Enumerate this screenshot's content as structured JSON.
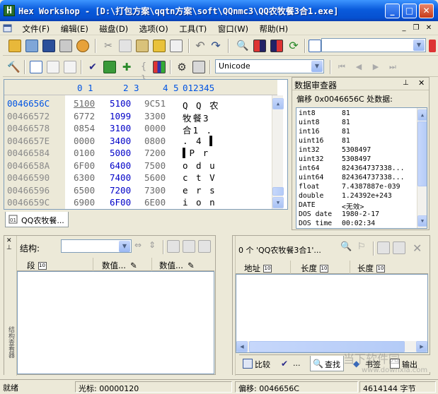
{
  "window": {
    "app_title": "Hex Workshop - [D:\\打包方案\\qqtn方案\\soft\\QQnmc3\\QQ农牧餐3合1.exe]"
  },
  "menu": [
    "文件(F)",
    "编辑(E)",
    "磁盘(D)",
    "选项(O)",
    "工具(T)",
    "窗口(W)",
    "帮助(H)"
  ],
  "toolbar": {
    "encoding_combo": "Unicode",
    "search_combo": ""
  },
  "hex_editor": {
    "header_hex": [
      "0 1",
      "2 3",
      "4 5"
    ],
    "header_ascii": "012345",
    "rows": [
      {
        "addr": "0046656C",
        "h1": "5100",
        "h2": "5100",
        "h3": "9C51",
        "ascii": "Q Q 农"
      },
      {
        "addr": "00466572",
        "h1": "6772",
        "h2": "1099",
        "h3": "3300",
        "ascii": "牧餐3"
      },
      {
        "addr": "00466578",
        "h1": "0854",
        "h2": "3100",
        "h3": "0000",
        "ascii": "合1 ."
      },
      {
        "addr": "0046657E",
        "h1": "0000",
        "h2": "3400",
        "h3": "0800",
        "ascii": ". 4 ▌"
      },
      {
        "addr": "00466584",
        "h1": "0100",
        "h2": "5000",
        "h3": "7200",
        "ascii": "▌P r"
      },
      {
        "addr": "0046658A",
        "h1": "6F00",
        "h2": "6400",
        "h3": "7500",
        "ascii": "o d u"
      },
      {
        "addr": "00466590",
        "h1": "6300",
        "h2": "7400",
        "h3": "5600",
        "ascii": "c t V"
      },
      {
        "addr": "00466596",
        "h1": "6500",
        "h2": "7200",
        "h3": "7300",
        "ascii": "e r s"
      },
      {
        "addr": "0046659C",
        "h1": "6900",
        "h2": "6F00",
        "h3": "6E00",
        "ascii": "i o n"
      }
    ],
    "doc_tab": "QQ农牧餐..."
  },
  "inspector": {
    "title": "数据审查器",
    "subtitle": "偏移 0x0046656C 处数据:",
    "rows": [
      {
        "name": "int8",
        "value": "81"
      },
      {
        "name": "uint8",
        "value": "81"
      },
      {
        "name": "int16",
        "value": "81"
      },
      {
        "name": "uint16",
        "value": "81"
      },
      {
        "name": "int32",
        "value": "5308497"
      },
      {
        "name": "uint32",
        "value": "5308497"
      },
      {
        "name": "int64",
        "value": "824364737338..."
      },
      {
        "name": "uint64",
        "value": "824364737338..."
      },
      {
        "name": "float",
        "value": "7.4387887e-039"
      },
      {
        "name": "double",
        "value": "1.24392e+243"
      },
      {
        "name": "DATE",
        "value": "<无效>"
      },
      {
        "name": "DOS date",
        "value": "1980-2-17"
      },
      {
        "name": "DOS time",
        "value": "00:02:34"
      }
    ]
  },
  "structure": {
    "label": "结构:",
    "grip_label": "结构查看器",
    "columns": [
      "段",
      "数值...",
      "数值..."
    ]
  },
  "find": {
    "result_text": "0 个 'QQ农牧餐3合1'...",
    "columns": [
      "地址",
      "长度",
      "长度"
    ],
    "tabs": [
      "比较",
      "...",
      "查找",
      "书签",
      "输出"
    ]
  },
  "status": {
    "ready": "就绪",
    "cursor": "光标:  00000120",
    "offset": "偏移:  0046656C",
    "size": "4614144 字节"
  },
  "watermark": {
    "line1": "当下软件园",
    "line2": "www.downxia.com"
  }
}
